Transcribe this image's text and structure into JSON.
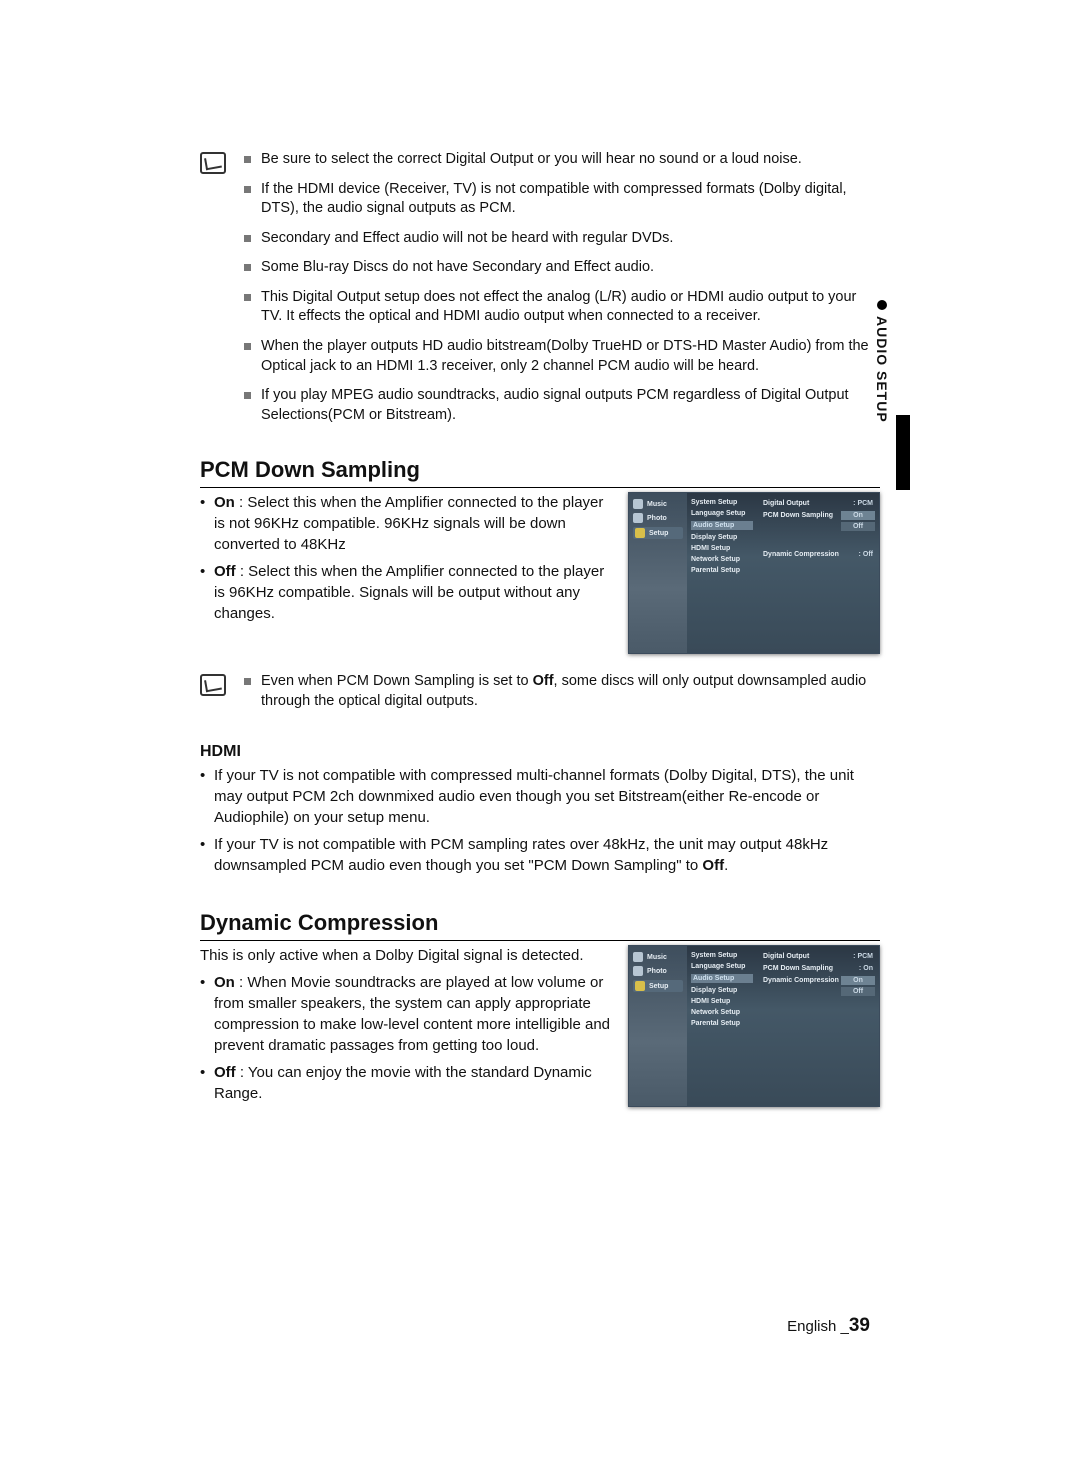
{
  "side_tab": {
    "bullet": "●",
    "label": "AUDIO SETUP"
  },
  "notes_top": [
    "Be sure to select the correct Digital Output or you will hear no sound or a loud noise.",
    "If the HDMI device (Receiver, TV) is not compatible with compressed formats (Dolby digital, DTS), the audio signal outputs as PCM.",
    "Secondary and Effect audio will not be heard with regular DVDs.",
    "Some Blu-ray Discs do not have Secondary and Effect audio.",
    "This Digital Output setup does not effect the analog (L/R) audio or HDMI audio output to your TV. It effects the optical and HDMI audio output when connected to a receiver.",
    "When the player outputs HD audio bitstream(Dolby TrueHD or DTS-HD Master Audio) from the Optical jack to an HDMI 1.3 receiver, only 2 channel PCM audio will be heard.",
    "If you play MPEG audio soundtracks, audio signal outputs PCM regardless of Digital Output Selections(PCM or Bitstream)."
  ],
  "section_pcm": {
    "title": "PCM Down Sampling",
    "bullets": [
      {
        "lead": "On",
        "rest": " : Select this when the Amplifier connected to the player is not 96KHz compatible. 96KHz signals will be down converted to 48KHz"
      },
      {
        "lead": "Off",
        "rest": " : Select this when the Amplifier connected to the player is 96KHz compatible. Signals will be output without any changes."
      }
    ],
    "note_items": [
      {
        "pre": "Even when PCM Down Sampling is set to ",
        "bold": "Off",
        "post": ", some discs will only output downsampled audio through the optical digital outputs."
      }
    ],
    "hdmi_title": "HDMI",
    "hdmi_bullets": [
      "If your TV is not compatible with compressed multi-channel formats (Dolby Digital, DTS), the unit may output PCM 2ch downmixed audio even though you set Bitstream(either Re-encode or Audiophile) on your setup menu.",
      {
        "pre": "If your TV is not compatible with PCM sampling rates over 48kHz, the unit may output 48kHz downsampled PCM audio even though you set \"PCM Down Sampling\" to ",
        "bold": "Off",
        "post": "."
      }
    ]
  },
  "section_dyn": {
    "title": "Dynamic Compression",
    "intro": "This is only active when a Dolby Digital signal is detected.",
    "bullets": [
      {
        "lead": "On",
        "rest": " : When Movie soundtracks are played at low volume or from smaller speakers, the system can apply appropriate compression to make low-level content more intelligible and prevent dramatic passages from getting too loud."
      },
      {
        "lead": "Off",
        "rest": " : You can enjoy the movie with the standard Dynamic Range."
      }
    ]
  },
  "menu_common": {
    "col1": [
      {
        "label": "Music"
      },
      {
        "label": "Photo"
      },
      {
        "label": "Setup",
        "sel": true
      }
    ],
    "col2": [
      "System Setup",
      "Language Setup",
      "Audio Setup",
      "Display Setup",
      "HDMI Setup",
      "Network Setup",
      "Parental Setup"
    ],
    "col2_sel_index": 2
  },
  "menu_pcm": {
    "rows": [
      {
        "label": "Digital Output",
        "val": "PCM"
      },
      {
        "label": "PCM Down Sampling",
        "val": "On",
        "popup": true,
        "opts": [
          "On",
          "Off"
        ],
        "opt_sel": 0
      },
      {
        "label": "Dynamic Compression",
        "val": "Off"
      }
    ]
  },
  "menu_dyn": {
    "rows": [
      {
        "label": "Digital Output",
        "val": "PCM"
      },
      {
        "label": "PCM Down Sampling",
        "val": "On"
      },
      {
        "label": "Dynamic Compression",
        "val": "On",
        "popup": true,
        "opts": [
          "On",
          "Off"
        ],
        "opt_sel": 0
      }
    ]
  },
  "footer": {
    "lang": "English",
    "sep": "_",
    "page": "39"
  }
}
